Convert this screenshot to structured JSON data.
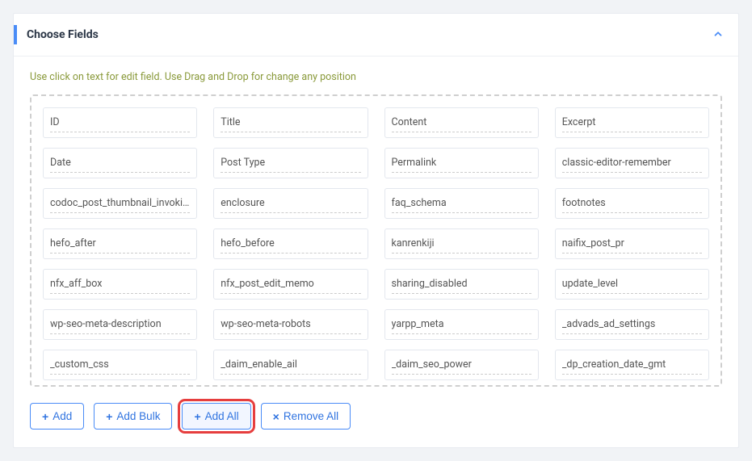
{
  "panel": {
    "title": "Choose Fields",
    "help_text": "Use click on text for edit field. Use Drag and Drop for change any position"
  },
  "fields": [
    "ID",
    "Title",
    "Content",
    "Excerpt",
    "Date",
    "Post Type",
    "Permalink",
    "classic-editor-remember",
    "codoc_post_thumbnail_invoking_entry",
    "enclosure",
    "faq_schema",
    "footnotes",
    "hefo_after",
    "hefo_before",
    "kanrenkiji",
    "naifix_post_pr",
    "nfx_aff_box",
    "nfx_post_edit_memo",
    "sharing_disabled",
    "update_level",
    "wp-seo-meta-description",
    "wp-seo-meta-robots",
    "yarpp_meta",
    "_advads_ad_settings",
    "_custom_css",
    "_daim_enable_ail",
    "_daim_seo_power",
    "_dp_creation_date_gmt"
  ],
  "buttons": {
    "add": "Add",
    "add_bulk": "Add Bulk",
    "add_all": "Add All",
    "remove_all": "Remove All"
  }
}
